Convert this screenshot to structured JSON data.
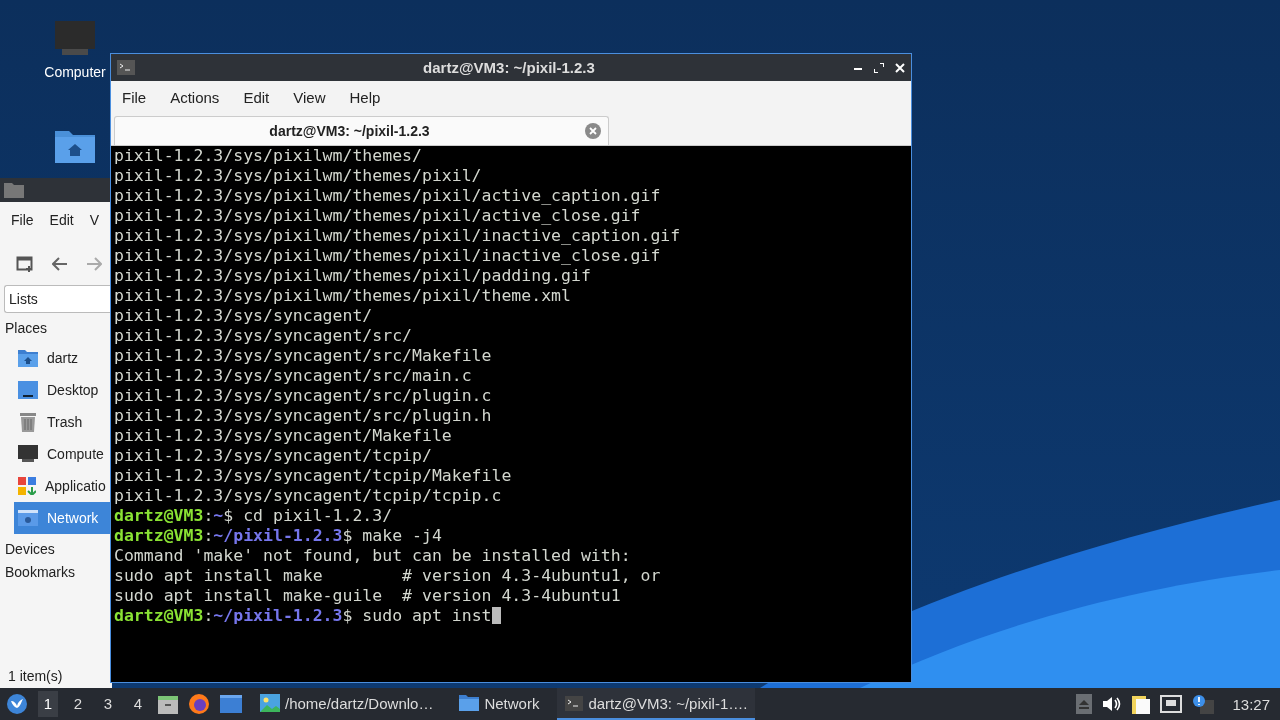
{
  "desktop_icons": [
    {
      "label": "Computer",
      "kind": "computer"
    },
    {
      "kind": "home"
    }
  ],
  "file_manager": {
    "menu": [
      "File",
      "Edit",
      "V"
    ],
    "places_dropdown": "Lists",
    "sections": [
      "Places",
      "Devices",
      "Bookmarks"
    ],
    "places": [
      {
        "label": "dartz",
        "kind": "home",
        "selected": false
      },
      {
        "label": "Desktop",
        "kind": "desktop",
        "selected": false
      },
      {
        "label": "Trash",
        "kind": "trash",
        "selected": false
      },
      {
        "label": "Compute",
        "kind": "computer",
        "selected": false
      },
      {
        "label": "Applicatio",
        "kind": "apps",
        "selected": false
      },
      {
        "label": "Network",
        "kind": "network",
        "selected": true
      }
    ],
    "status": "1 item(s)"
  },
  "terminal": {
    "window_title": "dartz@VM3: ~/pixil-1.2.3",
    "menu": [
      "File",
      "Actions",
      "Edit",
      "View",
      "Help"
    ],
    "tabs": [
      {
        "label": "dartz@VM3: ~/pixil-1.2.3",
        "selected": true
      }
    ],
    "lines": [
      {
        "kind": "output",
        "text": "pixil-1.2.3/sys/pixilwm/themes/"
      },
      {
        "kind": "output",
        "text": "pixil-1.2.3/sys/pixilwm/themes/pixil/"
      },
      {
        "kind": "output",
        "text": "pixil-1.2.3/sys/pixilwm/themes/pixil/active_caption.gif"
      },
      {
        "kind": "output",
        "text": "pixil-1.2.3/sys/pixilwm/themes/pixil/active_close.gif"
      },
      {
        "kind": "output",
        "text": "pixil-1.2.3/sys/pixilwm/themes/pixil/inactive_caption.gif"
      },
      {
        "kind": "output",
        "text": "pixil-1.2.3/sys/pixilwm/themes/pixil/inactive_close.gif"
      },
      {
        "kind": "output",
        "text": "pixil-1.2.3/sys/pixilwm/themes/pixil/padding.gif"
      },
      {
        "kind": "output",
        "text": "pixil-1.2.3/sys/pixilwm/themes/pixil/theme.xml"
      },
      {
        "kind": "output",
        "text": "pixil-1.2.3/sys/syncagent/"
      },
      {
        "kind": "output",
        "text": "pixil-1.2.3/sys/syncagent/src/"
      },
      {
        "kind": "output",
        "text": "pixil-1.2.3/sys/syncagent/src/Makefile"
      },
      {
        "kind": "output",
        "text": "pixil-1.2.3/sys/syncagent/src/main.c"
      },
      {
        "kind": "output",
        "text": "pixil-1.2.3/sys/syncagent/src/plugin.c"
      },
      {
        "kind": "output",
        "text": "pixil-1.2.3/sys/syncagent/src/plugin.h"
      },
      {
        "kind": "output",
        "text": "pixil-1.2.3/sys/syncagent/Makefile"
      },
      {
        "kind": "output",
        "text": "pixil-1.2.3/sys/syncagent/tcpip/"
      },
      {
        "kind": "output",
        "text": "pixil-1.2.3/sys/syncagent/tcpip/Makefile"
      },
      {
        "kind": "output",
        "text": "pixil-1.2.3/sys/syncagent/tcpip/tcpip.c"
      },
      {
        "kind": "prompt",
        "user": "dartz@VM3",
        "separator": ":",
        "path": "~",
        "symbol": "$",
        "command": "cd pixil-1.2.3/",
        "cursor": false
      },
      {
        "kind": "prompt",
        "user": "dartz@VM3",
        "separator": ":",
        "path": "~/pixil-1.2.3",
        "symbol": "$",
        "command": "make -j4",
        "cursor": false
      },
      {
        "kind": "output",
        "text": "Command 'make' not found, but can be installed with:"
      },
      {
        "kind": "output",
        "text": "sudo apt install make        # version 4.3-4ubuntu1, or"
      },
      {
        "kind": "output",
        "text": "sudo apt install make-guile  # version 4.3-4ubuntu1"
      },
      {
        "kind": "prompt",
        "user": "dartz@VM3",
        "separator": ":",
        "path": "~/pixil-1.2.3",
        "symbol": "$",
        "command": "sudo apt inst",
        "cursor": true
      }
    ]
  },
  "taskbar": {
    "workspaces": [
      {
        "label": "1",
        "selected": true
      },
      {
        "label": "2",
        "selected": false
      },
      {
        "label": "3",
        "selected": false
      },
      {
        "label": "4",
        "selected": false
      }
    ],
    "tasks": [
      {
        "label": "/home/dartz/Downlo…",
        "kind": "image",
        "selected": false
      },
      {
        "label": "Network",
        "kind": "folder",
        "selected": false
      },
      {
        "label": "dartz@VM3: ~/pixil-1….",
        "kind": "terminal",
        "selected": true
      }
    ],
    "clock": "13:27"
  }
}
